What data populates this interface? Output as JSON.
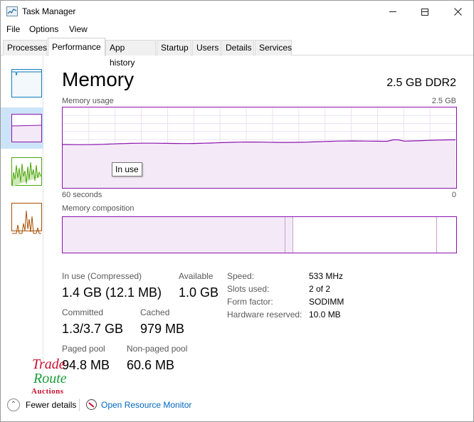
{
  "window": {
    "title": "Task Manager",
    "minimize": "—",
    "maximize": "☐",
    "close": "✕"
  },
  "menu": {
    "file": "File",
    "options": "Options",
    "view": "View"
  },
  "tabs": [
    "Processes",
    "Performance",
    "App history",
    "Startup",
    "Users",
    "Details",
    "Services"
  ],
  "active_tab": "Performance",
  "memory": {
    "title": "Memory",
    "capacity": "2.5 GB DDR2",
    "usage_label": "Memory usage",
    "usage_max": "2.5 GB",
    "time_left": "60 seconds",
    "time_right": "0",
    "tooltip": "In use",
    "composition_label": "Memory composition"
  },
  "stats": {
    "in_use_label": "In use (Compressed)",
    "in_use_value": "1.4 GB (12.1 MB)",
    "available_label": "Available",
    "available_value": "1.0 GB",
    "committed_label": "Committed",
    "committed_value": "1.3/3.7 GB",
    "cached_label": "Cached",
    "cached_value": "979 MB",
    "paged_label": "Paged pool",
    "paged_value": "94.8 MB",
    "nonpaged_label": "Non-paged pool",
    "nonpaged_value": "60.6 MB"
  },
  "details": {
    "speed_label": "Speed:",
    "speed_value": "533 MHz",
    "slots_label": "Slots used:",
    "slots_value": "2 of 2",
    "form_label": "Form factor:",
    "form_value": "SODIMM",
    "hw_label": "Hardware reserved:",
    "hw_value": "10.0 MB"
  },
  "footer": {
    "fewer_details": "Fewer details",
    "open_monitor": "Open Resource Monitor"
  },
  "watermark": {
    "line1": "Trade",
    "line2": "Route",
    "line3": "Auctions"
  },
  "colors": {
    "memory_accent": "#8b12ae",
    "fill": "#f4eaf7",
    "grid": "#ebe0ef",
    "link": "#0067c0",
    "cpu_green": "#4da60c",
    "disk_orange": "#a74f01"
  }
}
